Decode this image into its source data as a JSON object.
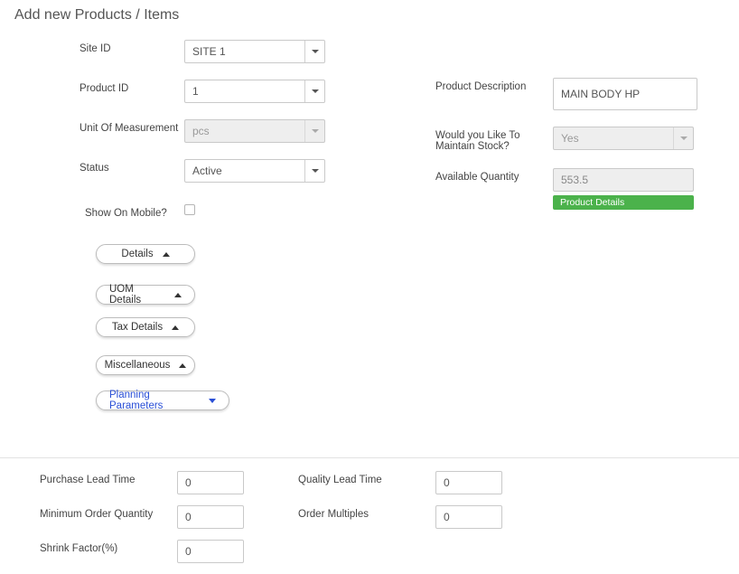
{
  "page_title": "Add new Products / Items",
  "left": {
    "site_id_label": "Site ID",
    "site_id_value": "SITE 1",
    "product_id_label": "Product ID",
    "product_id_value": "1",
    "uom_label": "Unit Of Measurement",
    "uom_value": "pcs",
    "status_label": "Status",
    "status_value": "Active",
    "show_mobile_label": "Show On Mobile?"
  },
  "right": {
    "desc_label": "Product Description",
    "desc_value": "MAIN BODY HP",
    "maintain_label": "Would you Like To Maintain Stock?",
    "maintain_value": "Yes",
    "avail_label": "Available Quantity",
    "avail_value": "553.5",
    "badge": "Product Details"
  },
  "accordion": {
    "details": "Details",
    "uom": "UOM Details",
    "tax": "Tax Details",
    "misc": "Miscellaneous",
    "planning": "Planning Parameters"
  },
  "params": {
    "purchase_lead_label": "Purchase Lead Time",
    "purchase_lead_value": "0",
    "min_order_label": "Minimum Order Quantity",
    "min_order_value": "0",
    "shrink_label": "Shrink Factor(%)",
    "shrink_value": "0",
    "quality_lead_label": "Quality Lead Time",
    "quality_lead_value": "0",
    "order_mult_label": "Order Multiples",
    "order_mult_value": "0"
  }
}
